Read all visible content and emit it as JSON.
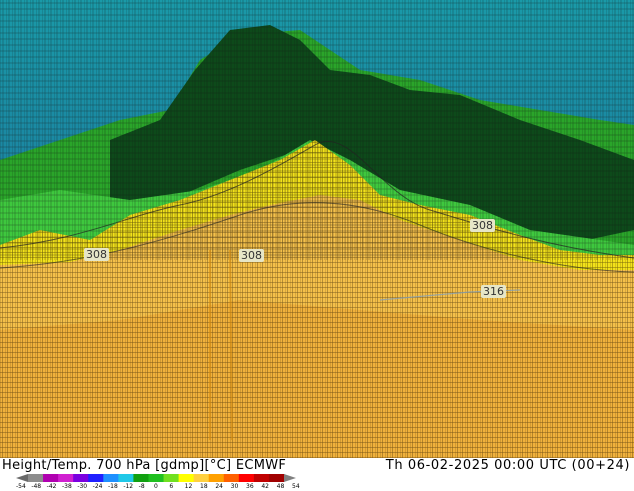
{
  "map": {
    "contour_labels": [
      {
        "id": "label-308-left",
        "text": "308"
      },
      {
        "id": "label-308-center",
        "text": "308"
      },
      {
        "id": "label-308-right",
        "text": "308"
      },
      {
        "id": "label-316",
        "text": "316"
      }
    ],
    "colors": {
      "cold_top": "#1a9aa8",
      "cold_blue": "#1b7fa0",
      "mountain_dark_green": "#0d4a1a",
      "mid_green": "#2aa52a",
      "bright_green": "#3ec83e",
      "yellow": "#f2e21a",
      "light_orange": "#f4c04a",
      "orange": "#eeae3a",
      "contour_line": "#111111"
    }
  },
  "footer": {
    "title": "Height/Temp. 700 hPa [gdmp][°C] ECMWF",
    "valid_time": "Th 06-02-2025 00:00 UTC (00+24)"
  },
  "colorbar": {
    "ticks": [
      "-54",
      "-48",
      "-42",
      "-38",
      "-30",
      "-24",
      "-18",
      "-12",
      "-8",
      "0",
      "6",
      "12",
      "18",
      "24",
      "30",
      "36",
      "42",
      "48",
      "54"
    ],
    "colors": [
      "#6a6a6a",
      "#8d8d8d",
      "#b000b0",
      "#d020d0",
      "#7a00e0",
      "#2020ff",
      "#1e90ff",
      "#20c8e8",
      "#10a010",
      "#20c020",
      "#70e020",
      "#ffff00",
      "#ffd040",
      "#ffa000",
      "#ff6000",
      "#ff0000",
      "#c00000",
      "#a00000",
      "#808080"
    ]
  }
}
